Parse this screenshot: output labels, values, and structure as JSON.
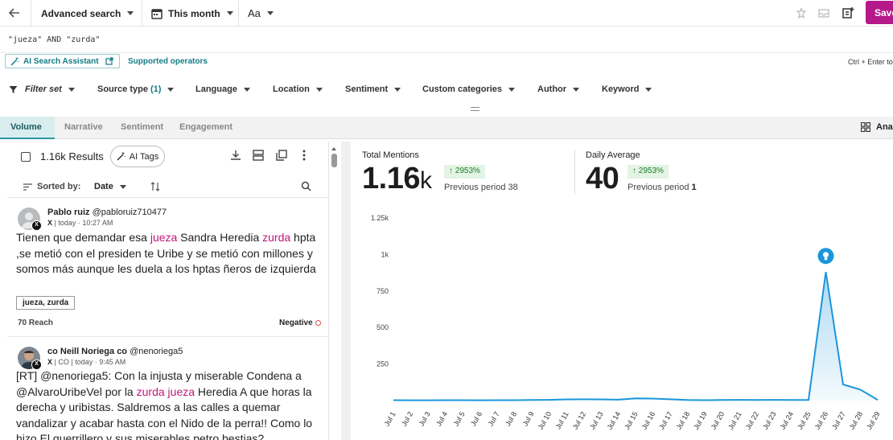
{
  "topbar": {
    "search_mode": "Advanced search",
    "date_range": "This month",
    "text_size": "Aa",
    "save_label": "Save"
  },
  "query": "\"jueza\" AND \"zurda\"",
  "assistant": {
    "ai_search": "AI Search Assistant",
    "supported": "Supported operators",
    "hint": "Ctrl + Enter to"
  },
  "filters": {
    "filter_set": "Filter set",
    "source_type": "Source type",
    "source_count": "(1)",
    "language": "Language",
    "location": "Location",
    "sentiment": "Sentiment",
    "custom": "Custom categories",
    "author": "Author",
    "keyword": "Keyword"
  },
  "tabs": {
    "volume": "Volume",
    "narrative": "Narrative",
    "sentiment": "Sentiment",
    "engagement": "Engagement",
    "right": "Ana"
  },
  "results": {
    "count": "1.16k Results",
    "ai_tags": "AI Tags",
    "sorted_by": "Sorted by:",
    "sort_value": "Date"
  },
  "posts": [
    {
      "author_name": "Pablo ruiz",
      "handle": "@pabloruiz710477",
      "meta_src": "X",
      "meta_rest": " | today · 10:27 AM",
      "text_parts": [
        "Tienen que demandar esa ",
        "jueza",
        " Sandra Heredia ",
        "zurda",
        " hpta ,se metió con el presiden te Uribe y se metió con millones y somos más aunque les duela a los hptas ñeros de izquierda"
      ],
      "keywords": "jueza, zurda",
      "reach": "70 Reach",
      "sentiment": "Negative"
    },
    {
      "author_name": "co Neill Noriega co",
      "handle": "@nenoriega5",
      "meta_src": "X",
      "meta_rest": " | CO | today · 9:45 AM",
      "text_parts": [
        "[RT] @nenoriega5: Con la injusta y miserable Condena a @AlvaroUribeVel por la ",
        "zurda",
        " ",
        "jueza",
        " Heredia A que horas la derecha y uribistas. Saldremos a las calles a quemar vandalizar y acabar hasta con el Nido de la perra!! Como lo hizo El guerrillero y sus miserables petro bestias?"
      ]
    }
  ],
  "stats": {
    "total": {
      "title": "Total Mentions",
      "value": "1.16",
      "unit": "k",
      "change": "2953%",
      "prev_label": "Previous period",
      "prev_value": "38"
    },
    "daily": {
      "title": "Daily Average",
      "value": "40",
      "change": "2953%",
      "prev_label": "Previous period",
      "prev_value": "1"
    }
  },
  "colors": {
    "accent": "#147c85",
    "brand": "#b5198a",
    "line": "#1a96dc",
    "highlight": "#c0157a"
  },
  "chart_data": {
    "type": "area",
    "title": "",
    "xlabel": "",
    "ylabel": "",
    "ylim": [
      0,
      1250
    ],
    "yticks": [
      250,
      500,
      750,
      1000,
      1250
    ],
    "ytick_labels": [
      "250",
      "500",
      "750",
      "1k",
      "1.25k"
    ],
    "grid": false,
    "x": [
      "Jul 1",
      "Jul 2",
      "Jul 3",
      "Jul 4",
      "Jul 5",
      "Jul 6",
      "Jul 7",
      "Jul 8",
      "Jul 9",
      "Jul 10",
      "Jul 11",
      "Jul 12",
      "Jul 13",
      "Jul 14",
      "Jul 15",
      "Jul 16",
      "Jul 17",
      "Jul 18",
      "Jul 19",
      "Jul 20",
      "Jul 21",
      "Jul 22",
      "Jul 23",
      "Jul 24",
      "Jul 25",
      "Jul 26",
      "Jul 27",
      "Jul 28",
      "Jul 29"
    ],
    "series": [
      {
        "values": [
          3,
          2,
          2,
          3,
          3,
          2,
          3,
          3,
          4,
          5,
          8,
          9,
          8,
          6,
          15,
          14,
          9,
          4,
          3,
          4,
          5,
          4,
          5,
          4,
          4,
          880,
          110,
          75,
          5
        ]
      }
    ],
    "annotation_x": "Jul 26"
  }
}
